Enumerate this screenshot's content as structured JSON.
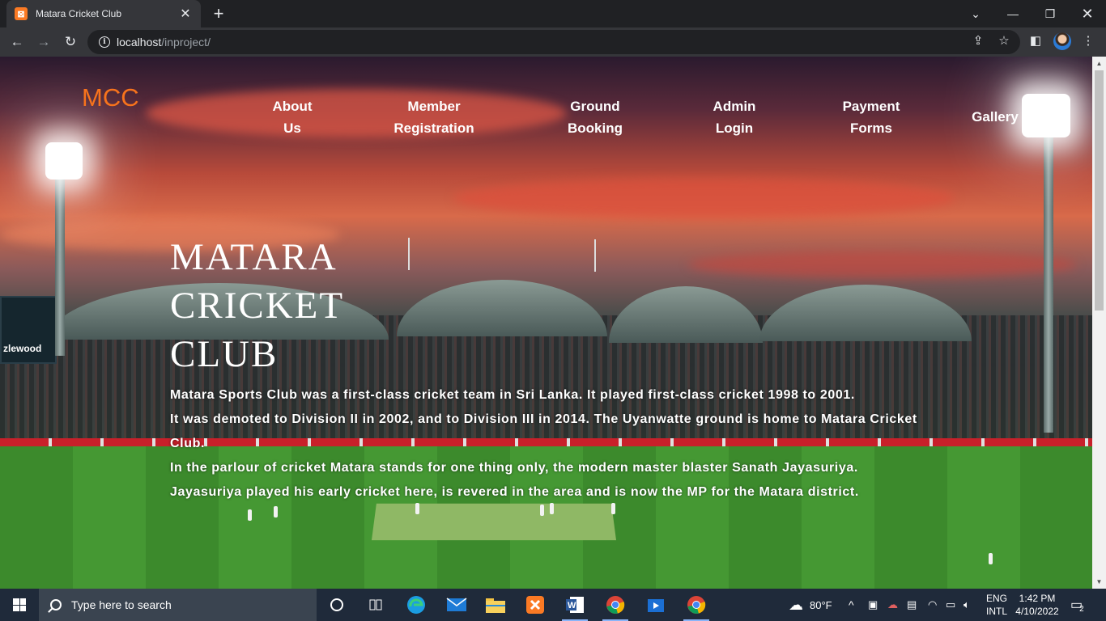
{
  "browser": {
    "tab_title": "Matara Cricket Club",
    "tab_favicon": "xampp-icon",
    "url_host": "localhost",
    "url_path": "/inproject/"
  },
  "site": {
    "logo": "MCC",
    "nav": [
      {
        "label": "About\nUs"
      },
      {
        "label": "Member\nRegistration"
      },
      {
        "label": "Ground\nBooking"
      },
      {
        "label": "Admin\nLogin"
      },
      {
        "label": "Payment\nForms"
      },
      {
        "label": "Gallery"
      }
    ],
    "hero_title": "MATARA CRICKET CLUB",
    "hero_paragraphs": [
      "Matara Sports Club was a first-class cricket team in Sri Lanka. It played first-class cricket 1998 to 2001.",
      "It was demoted to Division II in 2002, and to Division III in 2014. The Uyanwatte ground is home to Matara Cricket Club.",
      "In the parlour of cricket Matara stands for one thing only, the modern master blaster Sanath Jayasuriya.",
      "Jayasuriya played his early cricket here, is revered in the area and is now the MP for the Matara district."
    ],
    "scoreboard_text": "zlewood",
    "colors": {
      "logo": "#f7731c",
      "nav_text": "#ffffff"
    }
  },
  "taskbar": {
    "search_placeholder": "Type here to search",
    "weather": "80°F",
    "language_top": "ENG",
    "language_bottom": "INTL",
    "time": "1:42 PM",
    "date": "4/10/2022",
    "notification_count": "2"
  }
}
